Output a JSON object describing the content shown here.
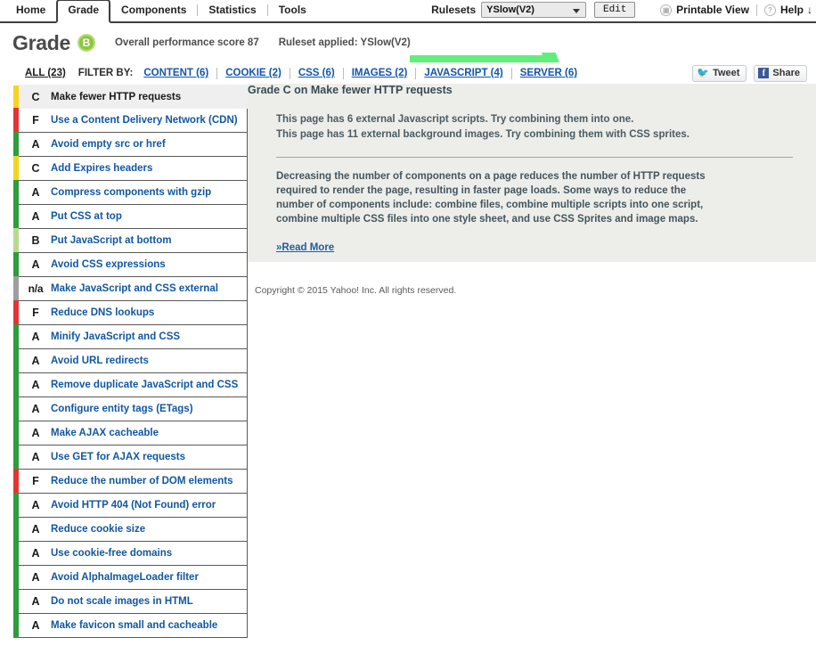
{
  "topnav": {
    "tabs": [
      {
        "label": "Home",
        "active": false
      },
      {
        "label": "Grade",
        "active": true
      },
      {
        "label": "Components",
        "active": false
      },
      {
        "label": "Statistics",
        "active": false
      },
      {
        "label": "Tools",
        "active": false
      }
    ],
    "rulesets_label": "Rulesets",
    "ruleset_selected": "YSlow(V2)",
    "edit_button": "Edit",
    "printable_view": "Printable View",
    "help": "Help",
    "help_arrow": "↓"
  },
  "header": {
    "title": "Grade",
    "badge_grade": "B",
    "score_text": "Overall performance score 87",
    "ruleset_text": "Ruleset applied: YSlow(V2)"
  },
  "filterbar": {
    "all": "ALL (23)",
    "filter_by": "FILTER BY:",
    "filters": [
      {
        "label": "CONTENT (6)"
      },
      {
        "label": "COOKIE (2)"
      },
      {
        "label": "CSS (6)"
      },
      {
        "label": "IMAGES (2)"
      },
      {
        "label": "JAVASCRIPT (4)"
      },
      {
        "label": "SERVER (6)"
      }
    ],
    "tweet": "Tweet",
    "share": "Share"
  },
  "colors": {
    "grade_a": "#2e9b3e",
    "grade_b": "#8fc96a",
    "grade_c": "#f5d321",
    "grade_f": "#e33434",
    "grade_na": "#9e9e9e",
    "link": "#1257a0",
    "panel_bg": "#edeeea",
    "highlight": "#5ef07a"
  },
  "rules": [
    {
      "grade": "C",
      "name": "Make fewer HTTP requests",
      "color": "#f5d321",
      "selected": true
    },
    {
      "grade": "F",
      "name": "Use a Content Delivery Network (CDN)",
      "color": "#e33434",
      "selected": false
    },
    {
      "grade": "A",
      "name": "Avoid empty src or href",
      "color": "#2e9b3e",
      "selected": false
    },
    {
      "grade": "C",
      "name": "Add Expires headers",
      "color": "#f5d321",
      "selected": false
    },
    {
      "grade": "A",
      "name": "Compress components with gzip",
      "color": "#2e9b3e",
      "selected": false
    },
    {
      "grade": "A",
      "name": "Put CSS at top",
      "color": "#2e9b3e",
      "selected": false
    },
    {
      "grade": "B",
      "name": "Put JavaScript at bottom",
      "color": "#b8d98f",
      "selected": false
    },
    {
      "grade": "A",
      "name": "Avoid CSS expressions",
      "color": "#2e9b3e",
      "selected": false
    },
    {
      "grade": "n/a",
      "name": "Make JavaScript and CSS external",
      "color": "#9e9e9e",
      "selected": false
    },
    {
      "grade": "F",
      "name": "Reduce DNS lookups",
      "color": "#e33434",
      "selected": false
    },
    {
      "grade": "A",
      "name": "Minify JavaScript and CSS",
      "color": "#2e9b3e",
      "selected": false
    },
    {
      "grade": "A",
      "name": "Avoid URL redirects",
      "color": "#2e9b3e",
      "selected": false
    },
    {
      "grade": "A",
      "name": "Remove duplicate JavaScript and CSS",
      "color": "#2e9b3e",
      "selected": false
    },
    {
      "grade": "A",
      "name": "Configure entity tags (ETags)",
      "color": "#2e9b3e",
      "selected": false
    },
    {
      "grade": "A",
      "name": "Make AJAX cacheable",
      "color": "#2e9b3e",
      "selected": false
    },
    {
      "grade": "A",
      "name": "Use GET for AJAX requests",
      "color": "#2e9b3e",
      "selected": false
    },
    {
      "grade": "F",
      "name": "Reduce the number of DOM elements",
      "color": "#e33434",
      "selected": false
    },
    {
      "grade": "A",
      "name": "Avoid HTTP 404 (Not Found) error",
      "color": "#2e9b3e",
      "selected": false
    },
    {
      "grade": "A",
      "name": "Reduce cookie size",
      "color": "#2e9b3e",
      "selected": false
    },
    {
      "grade": "A",
      "name": "Use cookie-free domains",
      "color": "#2e9b3e",
      "selected": false
    },
    {
      "grade": "A",
      "name": "Avoid AlphaImageLoader filter",
      "color": "#2e9b3e",
      "selected": false
    },
    {
      "grade": "A",
      "name": "Do not scale images in HTML",
      "color": "#2e9b3e",
      "selected": false
    },
    {
      "grade": "A",
      "name": "Make favicon small and cacheable",
      "color": "#2e9b3e",
      "selected": false
    }
  ],
  "detail": {
    "title": "Grade C on Make fewer HTTP requests",
    "findings": [
      "This page has 6 external Javascript scripts. Try combining them into one.",
      "This page has 11 external background images. Try combining them with CSS sprites."
    ],
    "body": "Decreasing the number of components on a page reduces the number of HTTP requests required to render the page, resulting in faster page loads. Some ways to reduce the number of components include: combine files, combine multiple scripts into one script, combine multiple CSS files into one style sheet, and use CSS Sprites and image maps.",
    "read_more": "»Read More"
  },
  "footer": {
    "copyright": "Copyright © 2015 Yahoo! Inc. All rights reserved."
  }
}
